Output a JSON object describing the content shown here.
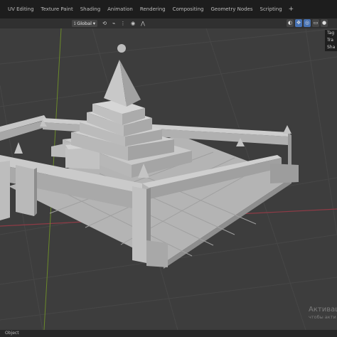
{
  "workspace_tabs": [
    "UV Editing",
    "Texture Paint",
    "Shading",
    "Animation",
    "Rendering",
    "Compositing",
    "Geometry Nodes",
    "Scripting"
  ],
  "workspace_add": "+",
  "header": {
    "orientation": "Global"
  },
  "properties_panel": {
    "lines": [
      "Tag",
      "Tra",
      "Sha"
    ]
  },
  "watermark": {
    "title": "Активац",
    "subtitle": "чтобы акти"
  },
  "status_bar": {
    "text": "Object"
  },
  "colors": {
    "background": "#3d3d3d",
    "x_axis": "#8f3b46",
    "y_axis": "#6b8a2a",
    "model_light": "#bdbdbd",
    "model_mid": "#a7a7a7",
    "model_dark": "#8b8b8b"
  }
}
